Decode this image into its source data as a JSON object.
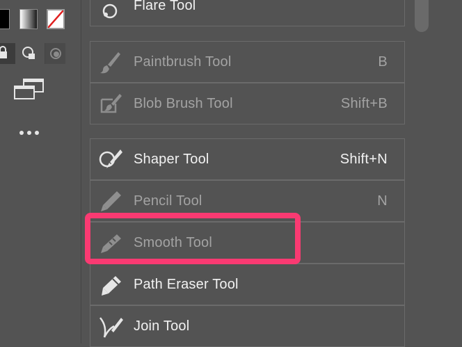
{
  "toolbar": {
    "swatches": [
      {
        "name": "fill-color",
        "color": "#000000"
      },
      {
        "name": "gradient",
        "color": "#ffffff"
      },
      {
        "name": "none",
        "color": "#e02020"
      }
    ],
    "draw_modes": [
      "draw-normal-icon",
      "draw-behind-icon",
      "draw-inside-icon"
    ],
    "screen_mode_icon": "screen-mode-icon",
    "more_icon": "more-ellipsis-icon"
  },
  "menu": {
    "items": [
      {
        "label": "Flare Tool",
        "shortcut": "",
        "icon": "flare-icon",
        "enabled": true
      },
      {
        "label": "Paintbrush Tool",
        "shortcut": "B",
        "icon": "paintbrush-icon",
        "enabled": false
      },
      {
        "label": "Blob Brush Tool",
        "shortcut": "Shift+B",
        "icon": "blob-brush-icon",
        "enabled": false
      },
      {
        "label": "Shaper Tool",
        "shortcut": "Shift+N",
        "icon": "shaper-icon",
        "enabled": true
      },
      {
        "label": "Pencil Tool",
        "shortcut": "N",
        "icon": "pencil-icon",
        "enabled": false
      },
      {
        "label": "Smooth Tool",
        "shortcut": "",
        "icon": "smooth-icon",
        "enabled": false
      },
      {
        "label": "Path Eraser Tool",
        "shortcut": "",
        "icon": "path-eraser-icon",
        "enabled": true
      },
      {
        "label": "Join Tool",
        "shortcut": "",
        "icon": "join-icon",
        "enabled": true
      }
    ]
  },
  "annotation": {
    "color": "#fa3a72",
    "target": "Smooth Tool"
  },
  "colors": {
    "background": "#535353",
    "text_enabled": "#f2f2f2",
    "text_disabled": "#a3a3a3",
    "border": "#6b6b6b"
  }
}
